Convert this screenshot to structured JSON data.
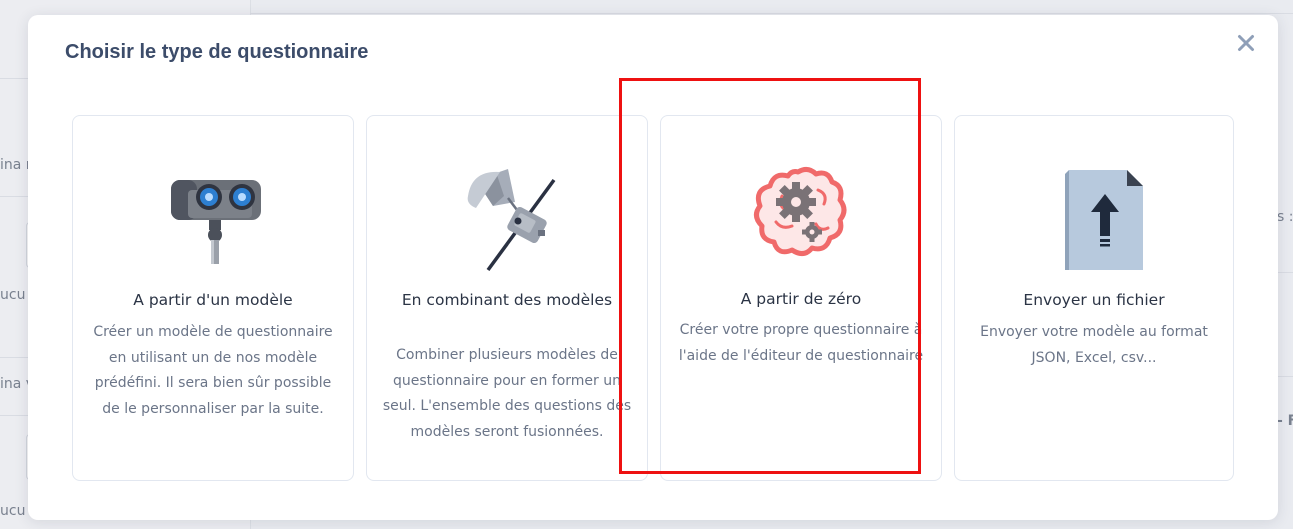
{
  "background": {
    "fragments": [
      "ina r",
      "ucu",
      "ina v",
      "ucu",
      "s : (",
      "- F"
    ]
  },
  "modal": {
    "title": "Choisir le type de questionnaire",
    "close_label": "×",
    "cards": [
      {
        "icon": "robot-eyes-icon",
        "title": "A partir d'un modèle",
        "description": "Créer un modèle de questionnaire en utilisant un de nos modèle prédéfini. Il sera bien sûr possible de le personnaliser par la suite."
      },
      {
        "icon": "satellite-icon",
        "title": "En combinant des modèles",
        "description": "Combiner plusieurs modèles de questionnaire pour en former un seul. L'ensemble des questions des modèles seront fusionnées."
      },
      {
        "icon": "brain-gears-icon",
        "title": "A partir de zéro",
        "description": "Créer votre propre questionnaire à l'aide de l'éditeur de questionnaire"
      },
      {
        "icon": "file-upload-icon",
        "title": "Envoyer un fichier",
        "description": "Envoyer votre modèle au format JSON, Excel, csv..."
      }
    ]
  },
  "colors": {
    "title": "#3c4c6a",
    "highlight": "#ee1111",
    "brain": "#f06a6a"
  }
}
